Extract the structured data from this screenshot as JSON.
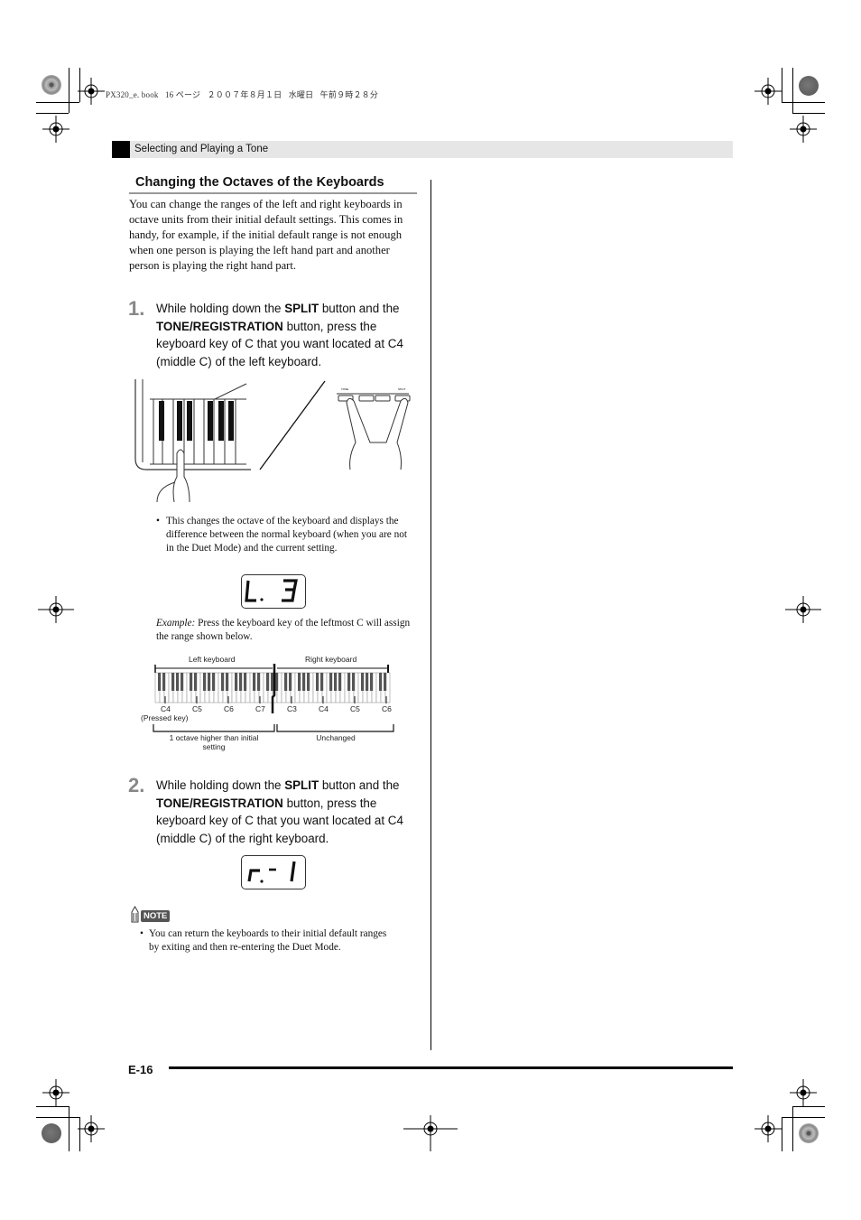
{
  "print_header": {
    "text": "PX320_e. book   16 ページ   ２００７年８月１日   水曜日   午前９時２８分"
  },
  "section": {
    "title": "Selecting and Playing a Tone"
  },
  "heading": "Changing the Octaves of the Keyboards",
  "intro": "You can change the ranges of the left and right keyboards in octave units from their initial default settings. This comes in handy, for example, if the initial default range is not enough when one person is playing the left hand part and another person is playing the right hand part.",
  "steps": [
    {
      "number": "1.",
      "pre": "While holding down the ",
      "bold1": "SPLIT",
      "mid": " button and the ",
      "bold2": "TONE/REGISTRATION",
      "post": " button, press the keyboard key of C that you want located at C4 (middle C) of the left keyboard."
    },
    {
      "number": "2.",
      "pre": "While holding down the ",
      "bold1": "SPLIT",
      "mid": " button and the ",
      "bold2": "TONE/REGISTRATION",
      "post": " button, press the keyboard key of C that you want located at C4 (middle C) of the right keyboard."
    }
  ],
  "bullet1": "This changes the octave of the keyboard and displays the difference between the normal keyboard (when you are not in the Duet Mode) and the current setting.",
  "lcd1": {
    "left": "L.",
    "right": "3"
  },
  "example": {
    "label": "Example:",
    "text": "Press the keyboard key of the leftmost C will assign the range shown below."
  },
  "keyboard_diagram": {
    "left_label": "Left keyboard",
    "right_label": "Right keyboard",
    "left_notes": [
      "C4",
      "C5",
      "C6",
      "C7"
    ],
    "right_notes": [
      "C3",
      "C4",
      "C5",
      "C6"
    ],
    "pressed_key": "(Pressed key)",
    "left_caption_line1": "1 octave higher than initial",
    "left_caption_line2": "setting",
    "right_caption": "Unchanged"
  },
  "lcd2": {
    "left": "r.",
    "mid": "-",
    "right": "1"
  },
  "note": {
    "badge": "NOTE",
    "text": "You can return the keyboards to their initial default ranges by exiting and then re-entering the Duet Mode."
  },
  "footer": {
    "page_number": "E-16"
  },
  "illustration_labels": {
    "tone": "TONE",
    "split": "SPLIT"
  }
}
